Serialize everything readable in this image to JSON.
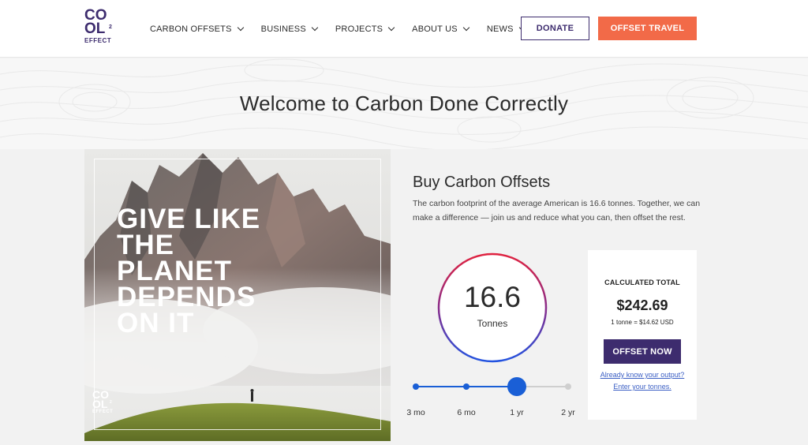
{
  "logo": {
    "line1": "CO",
    "line2": "OL",
    "sup": "2",
    "effect": "EFFECT"
  },
  "nav": {
    "items": [
      {
        "label": "CARBON OFFSETS",
        "icon": "chevron-down-icon"
      },
      {
        "label": "BUSINESS",
        "icon": "chevron-down-icon"
      },
      {
        "label": "PROJECTS",
        "icon": "chevron-down-icon"
      },
      {
        "label": "ABOUT US",
        "icon": "chevron-down-icon"
      },
      {
        "label": "NEWS",
        "icon": "chevron-down-icon"
      }
    ],
    "donate_label": "DONATE",
    "offset_travel_label": "OFFSET TRAVEL"
  },
  "hero": {
    "title": "Welcome to Carbon Done Correctly"
  },
  "photo": {
    "slogan": "GIVE LIKE\nTHE\nPLANET\nDEPENDS\nON IT",
    "logo_line1": "CO",
    "logo_line2": "OL",
    "logo_sup": "2",
    "logo_effect": "EFFECT"
  },
  "offsets": {
    "title": "Buy Carbon Offsets",
    "description": "The carbon footprint of the average American is 16.6 tonnes. Together, we can make a difference — join us and reduce what you can, then offset the rest.",
    "ring_value": "16.6",
    "ring_unit": "Tonnes",
    "slider": {
      "options": [
        "3 mo",
        "6 mo",
        "1 yr",
        "2 yr"
      ],
      "selected_index": 2
    }
  },
  "calculator": {
    "label": "CALCULATED TOTAL",
    "total": "$242.69",
    "rate": "1 tonne = $14.62 USD",
    "button_label": "OFFSET NOW",
    "link1": "Already know your output?",
    "link2": "Enter your tonnes."
  },
  "colors": {
    "brand_purple": "#3d2c6e",
    "accent_orange": "#f26a48",
    "ring_start": "#e0223f",
    "ring_end": "#2253e0",
    "slider_blue": "#1a5fd6",
    "link_blue": "#3b5fc4"
  }
}
